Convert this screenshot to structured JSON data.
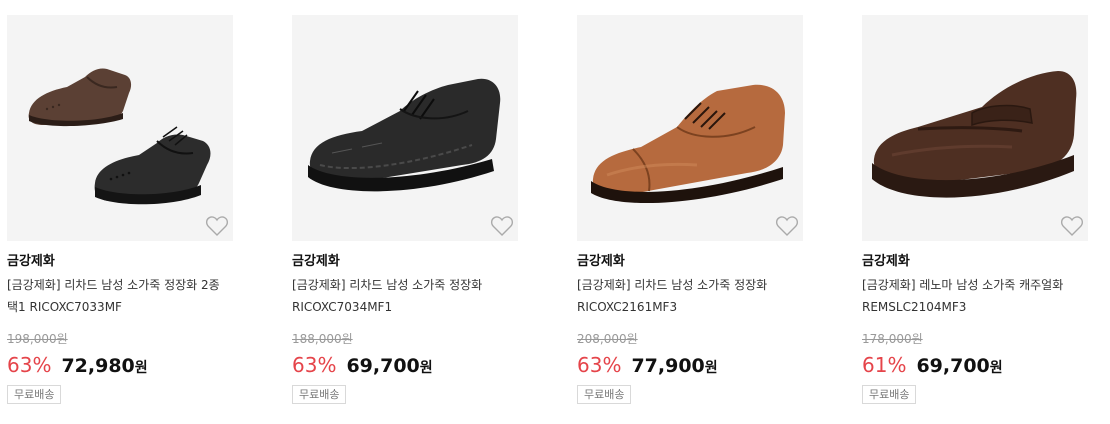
{
  "products": [
    {
      "brand": "금강제화",
      "title": "[금강제화] 리차드 남성 소가죽 정장화 2종 택1 RICOXC7033MF",
      "original_price": "198,000원",
      "discount_rate": "63%",
      "sale_price": "72,980",
      "currency": "원",
      "shipping_badge": "무료배송",
      "wishlist_icon": "heart-outline-icon"
    },
    {
      "brand": "금강제화",
      "title": "[금강제화] 리차드 남성 소가죽 정장화 RICOXC7034MF1",
      "original_price": "188,000원",
      "discount_rate": "63%",
      "sale_price": "69,700",
      "currency": "원",
      "shipping_badge": "무료배송",
      "wishlist_icon": "heart-outline-icon"
    },
    {
      "brand": "금강제화",
      "title": "[금강제화] 리차드 남성 소가죽 정장화 RICOXC2161MF3",
      "original_price": "208,000원",
      "discount_rate": "63%",
      "sale_price": "77,900",
      "currency": "원",
      "shipping_badge": "무료배송",
      "wishlist_icon": "heart-outline-icon"
    },
    {
      "brand": "금강제화",
      "title": "[금강제화] 레노마 남성 소가죽 캐주얼화 REMSLC2104MF3",
      "original_price": "178,000원",
      "discount_rate": "61%",
      "sale_price": "69,700",
      "currency": "원",
      "shipping_badge": "무료배송",
      "wishlist_icon": "heart-outline-icon"
    }
  ],
  "colors": {
    "discount": "#e5444a",
    "thumb_bg": "#f4f4f4",
    "strike": "#999999"
  }
}
